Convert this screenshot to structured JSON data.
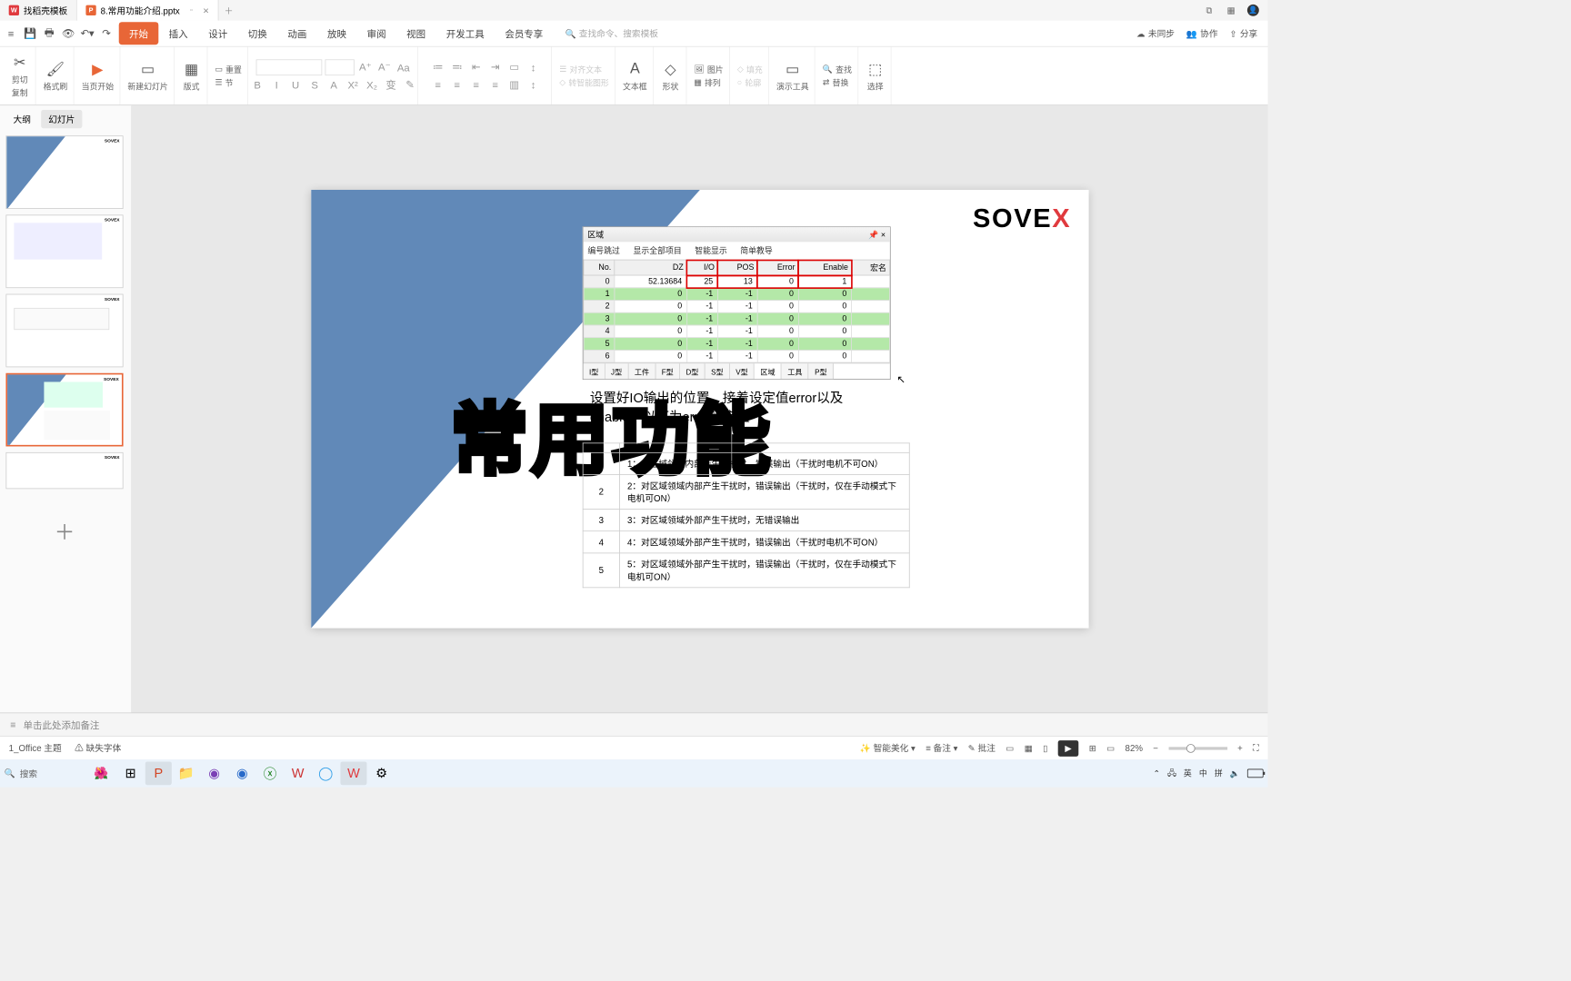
{
  "titlebar": {
    "tab1": "找稻壳模板",
    "tab2_icon": "P",
    "tab2": "8.常用功能介绍.pptx"
  },
  "ribbon": {
    "tabs": [
      "开始",
      "插入",
      "设计",
      "切换",
      "动画",
      "放映",
      "审阅",
      "视图",
      "开发工具",
      "会员专享"
    ],
    "search_placeholder": "查找命令、搜索模板",
    "sync": "未同步",
    "coop": "协作",
    "share": "分享"
  },
  "toolbar": {
    "cut": "剪切",
    "copy": "复制",
    "format_painter": "格式刷",
    "paste_label": "当页开始",
    "new_slide": "新建幻灯片",
    "layout": "版式",
    "section": "节",
    "reset": "重置",
    "align_text": "对齐文本",
    "smart_graphic": "转智能图形",
    "textbox": "文本框",
    "shape": "形状",
    "picture": "图片",
    "arrange": "排列",
    "fill": "填充",
    "outline": "轮廓",
    "demo_tool": "演示工具",
    "find": "查找",
    "replace": "替换",
    "select": "选择"
  },
  "leftpane": {
    "tab_outline": "大纲",
    "tab_slides": "幻灯片"
  },
  "slide": {
    "logo": "SOVE",
    "logo_x": "X",
    "panel_title": "区域",
    "toolbar_items": [
      "编号跳过",
      "显示全部项目",
      "智能显示",
      "简单教导"
    ],
    "headers": [
      "No.",
      "DZ",
      "I/O",
      "POS",
      "Error",
      "Enable",
      "宏名"
    ],
    "rows": [
      {
        "no": "0",
        "dz": "52.13684",
        "io": "25",
        "pos": "13",
        "err": "0",
        "en": "1",
        "hl": false
      },
      {
        "no": "1",
        "dz": "0",
        "io": "-1",
        "pos": "-1",
        "err": "0",
        "en": "0",
        "hl": true
      },
      {
        "no": "2",
        "dz": "0",
        "io": "-1",
        "pos": "-1",
        "err": "0",
        "en": "0",
        "hl": false
      },
      {
        "no": "3",
        "dz": "0",
        "io": "-1",
        "pos": "-1",
        "err": "0",
        "en": "0",
        "hl": true
      },
      {
        "no": "4",
        "dz": "0",
        "io": "-1",
        "pos": "-1",
        "err": "0",
        "en": "0",
        "hl": false
      },
      {
        "no": "5",
        "dz": "0",
        "io": "-1",
        "pos": "-1",
        "err": "0",
        "en": "0",
        "hl": true
      },
      {
        "no": "6",
        "dz": "0",
        "io": "-1",
        "pos": "-1",
        "err": "0",
        "en": "0",
        "hl": false
      }
    ],
    "bottom_tabs": [
      "I型",
      "J型",
      "工件",
      "F型",
      "D型",
      "S型",
      "V型",
      "区域",
      "工具",
      "P型"
    ],
    "paragraph1": "设置好IO输出的位置，接着设定值error以及",
    "paragraph2": "enable，以下为error设定值",
    "big_title": "常用功能",
    "desc_rows": [
      {
        "n": "1",
        "t": "1：对区域领域内部产生干扰时，错误输出（干扰时电机不可ON）"
      },
      {
        "n": "2",
        "t": "2：对区域领域内部产生干扰时，错误输出（干扰时，仅在手动模式下电机可ON）"
      },
      {
        "n": "3",
        "t": "3：对区域领域外部产生干扰时，无错误输出"
      },
      {
        "n": "4",
        "t": "4：对区域领域外部产生干扰时，错误输出（干扰时电机不可ON）"
      },
      {
        "n": "5",
        "t": "5：对区域领域外部产生干扰时，错误输出（干扰时，仅在手动模式下电机可ON）"
      }
    ]
  },
  "notes": {
    "placeholder": "单击此处添加备注"
  },
  "status": {
    "theme": "1_Office 主题",
    "missing_font": "缺失字体",
    "beautify": "智能美化",
    "notes_btn": "备注",
    "comment_btn": "批注",
    "zoom": "82%"
  },
  "taskbar": {
    "search": "搜索",
    "ime1": "英",
    "ime2": "中",
    "ime3": "拼"
  }
}
